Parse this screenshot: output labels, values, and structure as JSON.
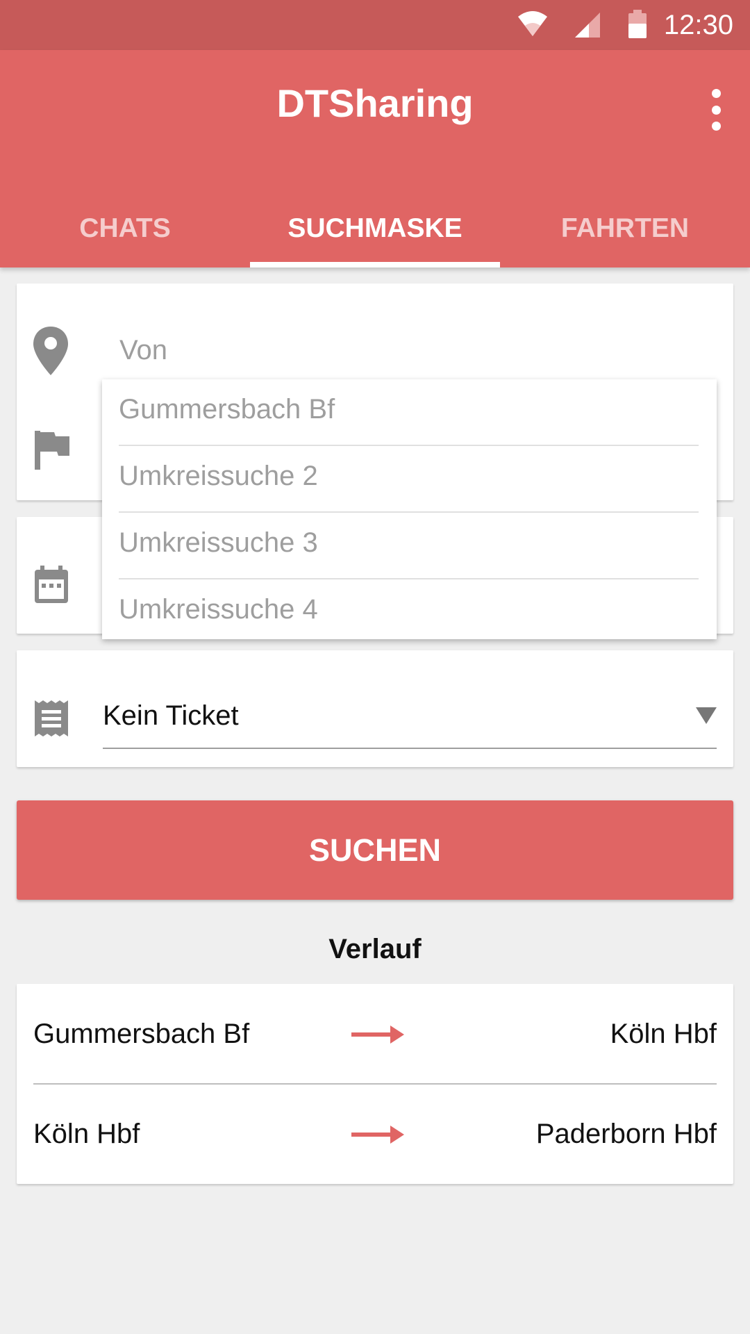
{
  "status_bar": {
    "time": "12:30",
    "icons": [
      "wifi-icon",
      "signal-icon",
      "battery-icon"
    ]
  },
  "app_bar": {
    "title": "DTSharing",
    "overflow_icon": "more-vert-icon"
  },
  "tabs": [
    {
      "label": "CHATS",
      "active": false
    },
    {
      "label": "SUCHMASKE",
      "active": true
    },
    {
      "label": "FAHRTEN",
      "active": false
    }
  ],
  "form": {
    "from_placeholder": "Von",
    "from_icon": "location-pin-icon",
    "to_icon": "flag-icon",
    "date_icon": "calendar-icon",
    "ticket_icon": "receipt-icon",
    "ticket_value": "Kein Ticket"
  },
  "suggestions": [
    "Gummersbach Bf",
    "Umkreissuche 2",
    "Umkreissuche 3",
    "Umkreissuche 4"
  ],
  "search_button": "SUCHEN",
  "history": {
    "title": "Verlauf",
    "rows": [
      {
        "from": "Gummersbach Bf",
        "to": "Köln Hbf"
      },
      {
        "from": "Köln Hbf",
        "to": "Paderborn Hbf"
      }
    ]
  },
  "colors": {
    "primary": "#e06564",
    "primary_dark": "#c65a59",
    "background": "#efefef"
  }
}
